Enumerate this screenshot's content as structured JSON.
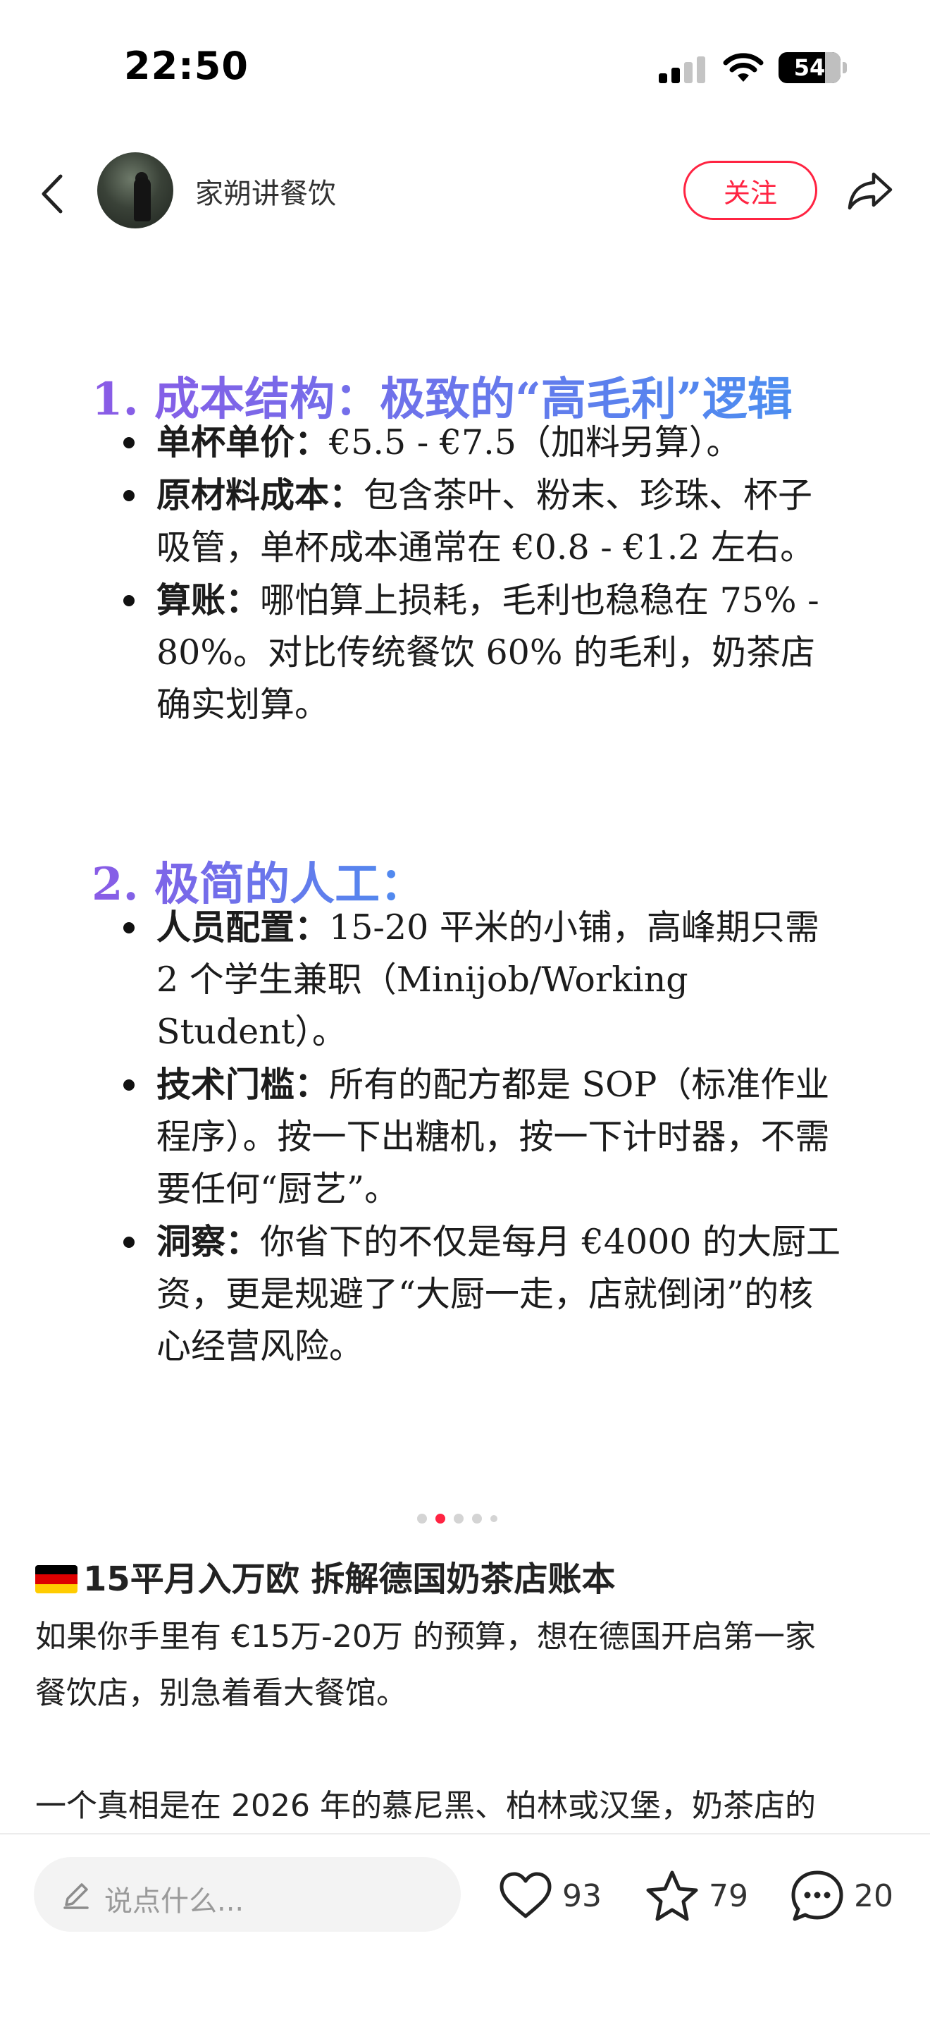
{
  "status_bar": {
    "time": "22:50",
    "battery_percent": "54",
    "battery_level": 0.54
  },
  "nav": {
    "author_name": "家朔讲餐饮",
    "follow_label": "关注"
  },
  "slide": {
    "sections": [
      {
        "heading": "1. 成本结构：极致的“高毛利”逻辑",
        "items": [
          {
            "label": "单杯单价：",
            "text": "€5.5 - €7.5（加料另算）。"
          },
          {
            "label": "原材料成本：",
            "text": "包含茶叶、粉末、珍珠、杯子吸管，单杯成本通常在 €0.8 - €1.2 左右。"
          },
          {
            "label": "算账：",
            "text": "哪怕算上损耗，毛利也稳稳在 75% - 80%。对比传统餐饮 60% 的毛利，奶茶店确实划算。"
          }
        ]
      },
      {
        "heading": "2. 极简的人工：",
        "items": [
          {
            "label": "人员配置：",
            "text": "15-20 平米的小铺，高峰期只需 2 个学生兼职（Minijob/Working Student）。"
          },
          {
            "label": "技术门槛：",
            "text": "所有的配方都是 SOP（标准作业程序）。按一下出糖机，按一下计时器，不需要任何“厨艺”。"
          },
          {
            "label": "洞察：",
            "text": "你省下的不仅是每月 €4000 的大厨工资，更是规避了“大厨一走，店就倒闭”的核心经营风险。"
          }
        ]
      }
    ]
  },
  "pager": {
    "count": 5,
    "active_index": 1
  },
  "note": {
    "title": "15平月入万欧 拆解德国奶茶店账本",
    "flag_colors": [
      "#000000",
      "#dd0000",
      "#ffcc00"
    ],
    "body_line_1": "如果你手里有 €15万-20万 的预算，想在德国开启第一家",
    "body_line_2": "餐饮店，别急着看大餐馆。",
    "body_line_3": "一个真相是在 2026 年的慕尼黑、柏林或汉堡，奶茶店的"
  },
  "bottom_bar": {
    "comment_placeholder": "说点什么...",
    "like_count": "93",
    "collect_count": "79",
    "comment_count": "20"
  },
  "colors": {
    "accent": "#ff2442",
    "heading_gradient_start": "#8a5be6",
    "heading_gradient_end": "#4c8ef0"
  },
  "icons": [
    "back-icon",
    "share-icon",
    "pencil-icon",
    "heart-icon",
    "star-icon",
    "comment-icon",
    "wifi-icon",
    "signal-icon",
    "battery-icon"
  ]
}
